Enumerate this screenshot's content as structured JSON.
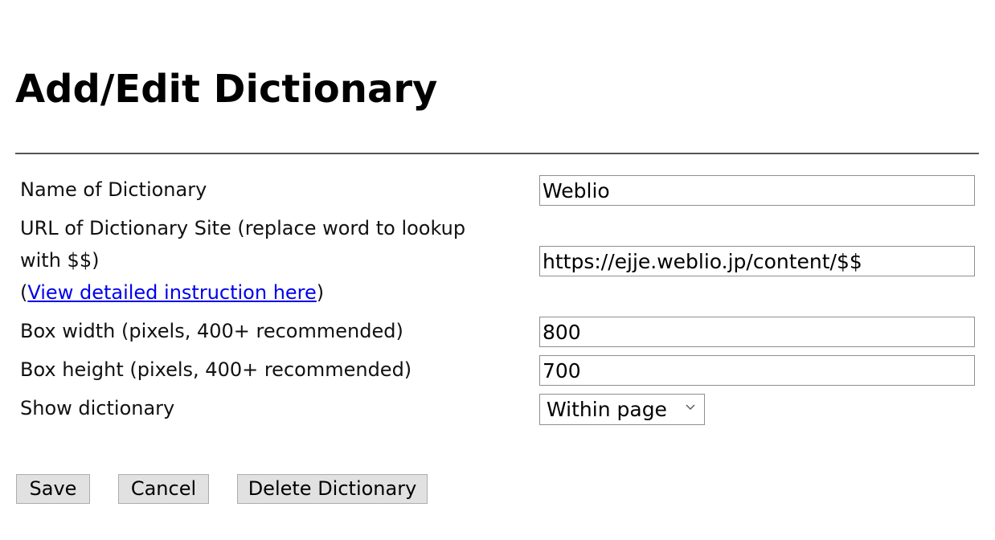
{
  "dialog": {
    "title": "Add/Edit Dictionary"
  },
  "form": {
    "name_label": "Name of Dictionary",
    "name_value": "Weblio",
    "url_label_line1": "URL of Dictionary Site (replace word to lookup",
    "url_label_line2": "with $$)",
    "url_help_open": "(",
    "url_help_link": "View detailed instruction here",
    "url_help_close": ")",
    "url_value": "https://ejje.weblio.jp/content/$$",
    "width_label": "Box width (pixels, 400+ recommended)",
    "width_value": "800",
    "height_label": "Box height (pixels, 400+ recommended)",
    "height_value": "700",
    "show_label": "Show dictionary",
    "show_selected": "Within page"
  },
  "buttons": {
    "save": "Save",
    "cancel": "Cancel",
    "delete": "Delete Dictionary"
  },
  "icons": {
    "select_arrow": "chevron-down-icon"
  }
}
